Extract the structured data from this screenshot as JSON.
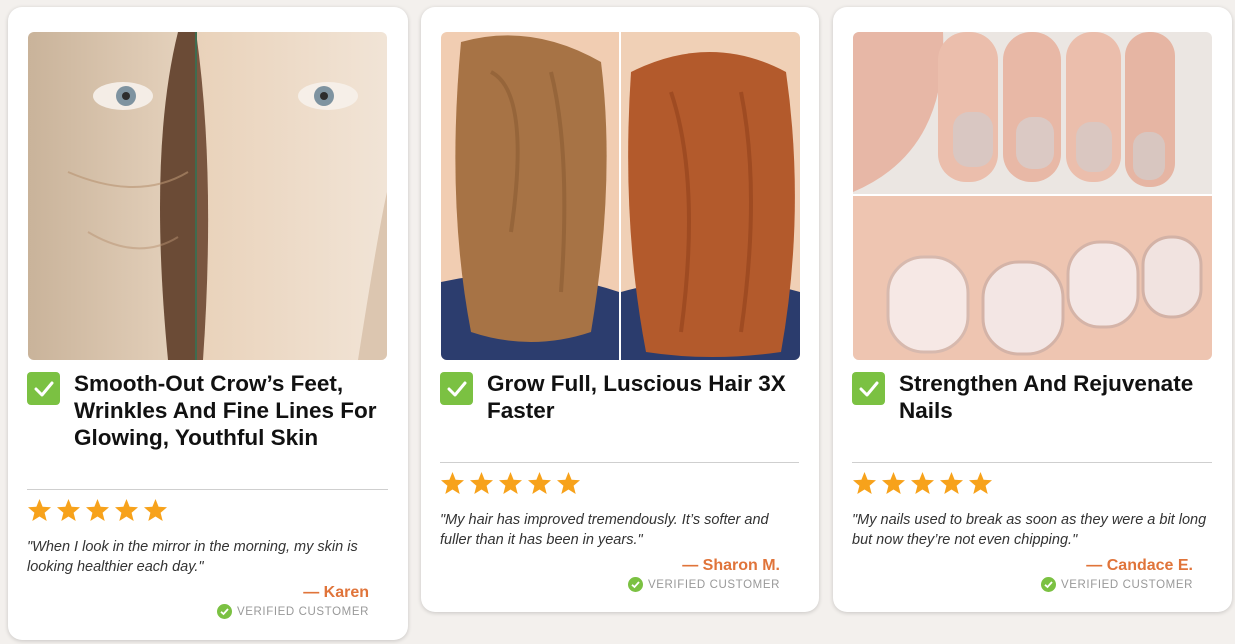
{
  "colors": {
    "check": "#7bc142",
    "star": "#f7a21b",
    "author": "#e0743a",
    "verified_icon": "#7bc142"
  },
  "cards": [
    {
      "image": "skin-before-after-photo",
      "headline": "Smooth-Out Crow’s Feet, Wrinkles And Fine Lines For Glowing, Youthful Skin",
      "rating": 5,
      "quote": "\"When I look in the mirror in the morning, my skin is looking healthier each day.\"",
      "author": "— Karen",
      "verified": "VERIFIED CUSTOMER"
    },
    {
      "image": "hair-before-after-photo",
      "headline": "Grow Full, Luscious Hair 3X Faster",
      "rating": 5,
      "quote": "\"My hair has improved tremendously. It’s softer and fuller than it has been in years.\"",
      "author": "— Sharon M.",
      "verified": "VERIFIED CUSTOMER"
    },
    {
      "image": "nails-before-after-photo",
      "headline": "Strengthen And Rejuvenate Nails",
      "rating": 5,
      "quote": "\"My nails used to break as soon as they were a bit long but now they’re not even chipping.\"",
      "author": "— Candace E.",
      "verified": "VERIFIED CUSTOMER"
    }
  ]
}
